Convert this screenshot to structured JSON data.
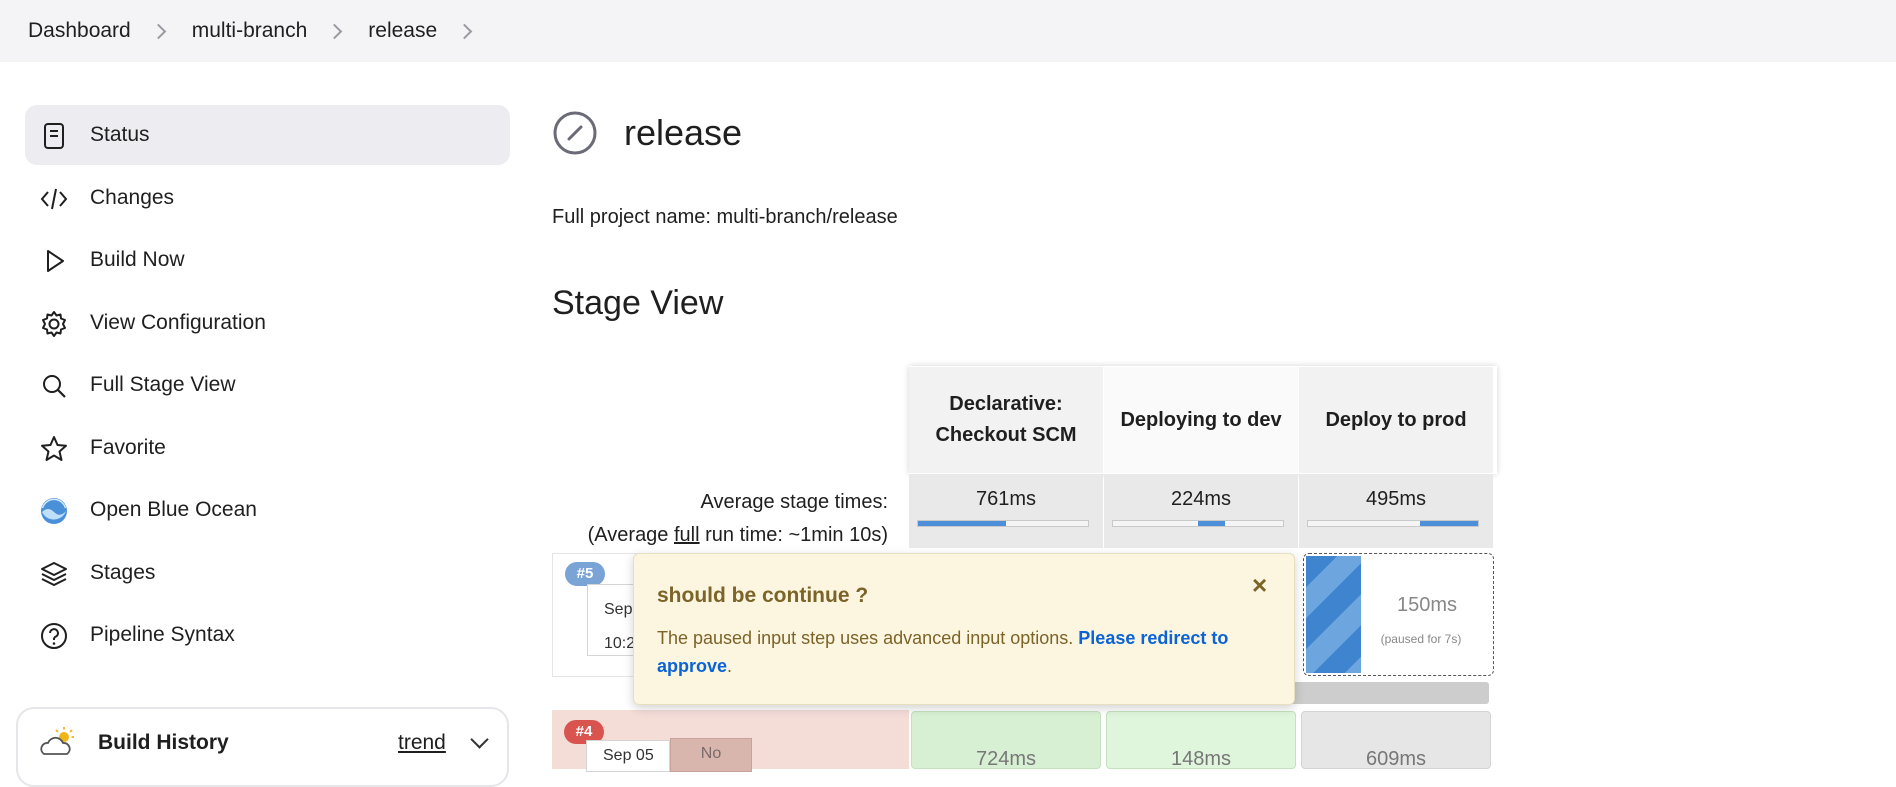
{
  "breadcrumb": [
    "Dashboard",
    "multi-branch",
    "release"
  ],
  "sidebar": {
    "items": [
      {
        "label": "Status",
        "icon": "document-icon"
      },
      {
        "label": "Changes",
        "icon": "code-icon"
      },
      {
        "label": "Build Now",
        "icon": "play-icon"
      },
      {
        "label": "View Configuration",
        "icon": "gear-icon"
      },
      {
        "label": "Full Stage View",
        "icon": "search-icon"
      },
      {
        "label": "Favorite",
        "icon": "star-icon"
      },
      {
        "label": "Open Blue Ocean",
        "icon": "blue-ocean-icon"
      },
      {
        "label": "Stages",
        "icon": "layers-icon"
      },
      {
        "label": "Pipeline Syntax",
        "icon": "help-icon"
      }
    ]
  },
  "build_history": {
    "title": "Build History",
    "trend": "trend"
  },
  "page": {
    "title": "release",
    "full_name": "Full project name: multi-branch/release",
    "stage_view_title": "Stage View"
  },
  "stages": {
    "headers": [
      "Declarative: Checkout SCM",
      "Deploying to dev",
      "Deploy to prod"
    ],
    "avg_label_1": "Average stage times:",
    "avg_label_2_pre": "(Average ",
    "avg_label_2_link": "full",
    "avg_label_2_post": " run time: ~1min 10s)",
    "avg_times": [
      "761ms",
      "224ms",
      "495ms"
    ],
    "avg_bar_fill": [
      {
        "start": 0.0,
        "end": 0.52
      },
      {
        "start": 0.5,
        "end": 0.66
      },
      {
        "start": 0.66,
        "end": 1.0
      }
    ]
  },
  "runs": [
    {
      "badge": "#5",
      "date": "Sep",
      "time": "10:2",
      "paused_ms": "150ms",
      "paused_note": "(paused for 7s)"
    },
    {
      "badge": "#4",
      "date": "Sep 05",
      "changes": "No",
      "stage_times": [
        "724ms",
        "148ms",
        "609ms"
      ]
    }
  ],
  "popup": {
    "title": "should be continue ?",
    "close": "×",
    "message": "The paused input step uses advanced input options. ",
    "link": "Please redirect to approve",
    "end": "."
  },
  "colors": {
    "accent": "#4d8fd8",
    "failed_badge": "#d9534f",
    "running_badge": "#7aa4d6"
  }
}
